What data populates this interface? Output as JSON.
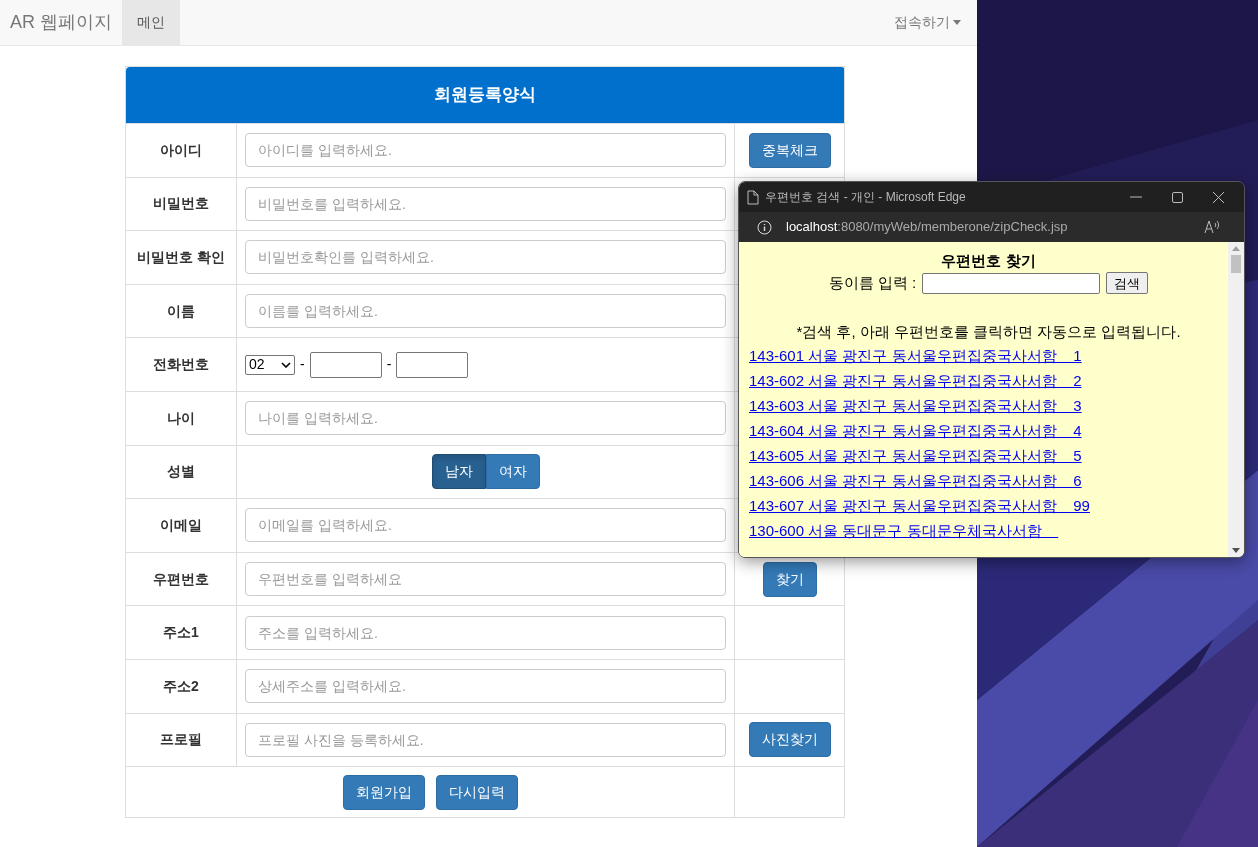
{
  "navbar": {
    "brand": "AR 웹페이지",
    "tabs": [
      {
        "label": "메인",
        "selected": true
      }
    ],
    "dropdown": "접속하기"
  },
  "form": {
    "title": "회원등록양식",
    "rows": [
      {
        "kind": "text",
        "label": "아이디",
        "placeholder": "아이디를 입력하세요.",
        "button": "중복체크"
      },
      {
        "kind": "text",
        "label": "비밀번호",
        "placeholder": "비밀번호를 입력하세요."
      },
      {
        "kind": "text",
        "label": "비밀번호 확인",
        "placeholder": "비밀번호확인를 입력하세요."
      },
      {
        "kind": "text",
        "label": "이름",
        "placeholder": "이름를 입력하세요."
      },
      {
        "kind": "phone",
        "label": "전화번호",
        "prefix": "02",
        "separators": [
          "-",
          "-"
        ]
      },
      {
        "kind": "text",
        "label": "나이",
        "placeholder": "나이를 입력하세요."
      },
      {
        "kind": "gender",
        "label": "성별",
        "options": [
          {
            "label": "남자",
            "selected": true
          },
          {
            "label": "여자",
            "selected": false
          }
        ]
      },
      {
        "kind": "text",
        "label": "이메일",
        "placeholder": "이메일를 입력하세요."
      },
      {
        "kind": "text",
        "label": "우편번호",
        "placeholder": "우편번호를 입력하세요",
        "button": "찾기"
      },
      {
        "kind": "text",
        "label": "주소1",
        "placeholder": "주소를 입력하세요."
      },
      {
        "kind": "text",
        "label": "주소2",
        "placeholder": "상세주소를 입력하세요."
      },
      {
        "kind": "text",
        "label": "프로필",
        "placeholder": "프로필 사진을 등록하세요.",
        "button": "사진찾기"
      }
    ],
    "actions": [
      "회원가입",
      "다시입력"
    ]
  },
  "popup": {
    "title": "우편번호 검색 - 개인 - Microsoft Edge",
    "url_host": "localhost",
    "url_rest": ":8080/myWeb/memberone/zipCheck.jsp",
    "heading": "우편번호 찾기",
    "search_label": "동이름 입력 :",
    "search_button": "검색",
    "notice": "*검색 후, 아래 우편번호를 클릭하면 자동으로 입력됩니다.",
    "results": [
      "143-601 서울 광진구 동서울우편집중국사서함    1",
      "143-602 서울 광진구 동서울우편집중국사서함    2",
      "143-603 서울 광진구 동서울우편집중국사서함    3",
      "143-604 서울 광진구 동서울우편집중국사서함    4",
      "143-605 서울 광진구 동서울우편집중국사서함    5",
      "143-606 서울 광진구 동서울우편집중국사서함    6",
      "143-607 서울 광진구 동서울우편집중국사서함    99",
      "130-600 서울 동대문구 동대문우체국사서함    "
    ]
  }
}
